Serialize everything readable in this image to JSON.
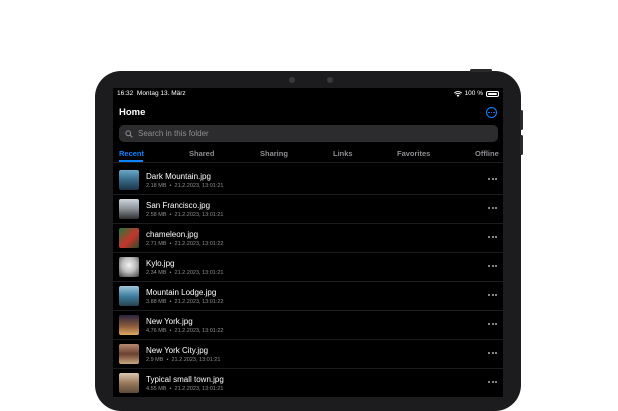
{
  "status": {
    "time": "16:32",
    "date": "Montag 13. März",
    "battery": "100 %"
  },
  "header": {
    "title": "Home",
    "more_icon": "ellipsis-circle-icon"
  },
  "search": {
    "placeholder": "Search in this folder"
  },
  "tabs": [
    {
      "label": "Recent",
      "active": true
    },
    {
      "label": "Shared"
    },
    {
      "label": "Sharing"
    },
    {
      "label": "Links"
    },
    {
      "label": "Favorites"
    },
    {
      "label": "Offline"
    }
  ],
  "files": [
    {
      "name": "Dark Mountain.jpg",
      "size": "2.18 MB",
      "date": "21.2.2023, 13:01:21"
    },
    {
      "name": "San Francisco.jpg",
      "size": "2.58 MB",
      "date": "21.2.2023, 13:01:21"
    },
    {
      "name": "chameleon.jpg",
      "size": "2.71 MB",
      "date": "21.2.2023, 13:01:22"
    },
    {
      "name": "Kylo.jpg",
      "size": "2.34 MB",
      "date": "21.2.2023, 13:01:21"
    },
    {
      "name": "Mountain Lodge.jpg",
      "size": "3.88 MB",
      "date": "21.2.2023, 13:01:22"
    },
    {
      "name": "New York.jpg",
      "size": "4.76 MB",
      "date": "21.2.2023, 13:01:22"
    },
    {
      "name": "New York City.jpg",
      "size": "2.9 MB",
      "date": "21.2.2023, 13:01:21"
    },
    {
      "name": "Typical small town.jpg",
      "size": "4.55 MB",
      "date": "21.2.2023, 13:01:21"
    }
  ],
  "colors": {
    "accent": "#0a84ff",
    "background": "#000000",
    "secondary_text": "#8e8e93"
  }
}
